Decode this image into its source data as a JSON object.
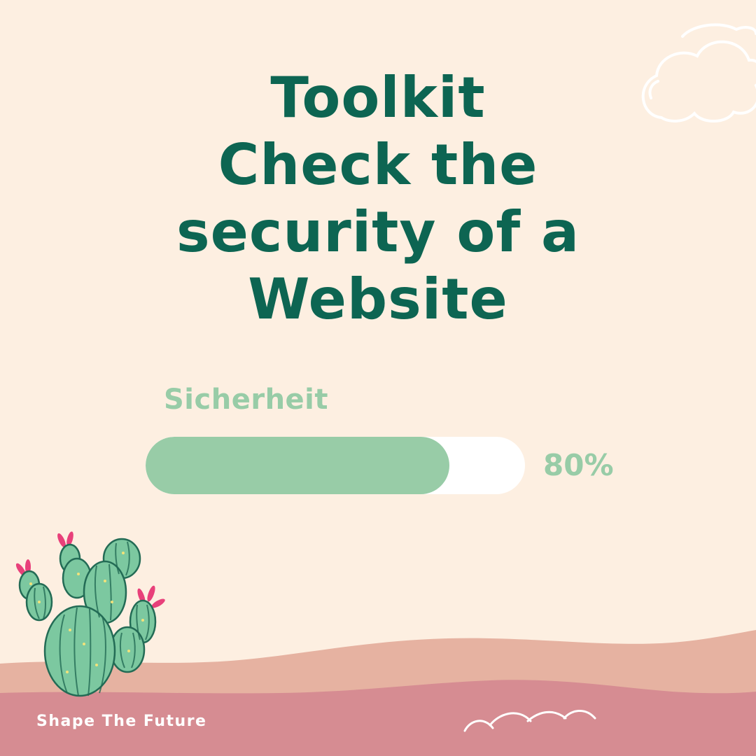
{
  "title": {
    "lines": [
      "Toolkit",
      "Check the",
      "security of a",
      "Website"
    ]
  },
  "progress": {
    "label": "Sicherheit",
    "value_text": "80%",
    "fraction": 0.8
  },
  "footer": {
    "brand": "Shape The Future"
  },
  "colors": {
    "background": "#fdefe1",
    "title": "#0d6552",
    "accent_green": "#98cca7",
    "dune_light": "#e6b2a1",
    "dune_dark": "#d68c92",
    "cactus": "#7cc8a0",
    "flower": "#e8407a"
  },
  "decorations": {
    "cloud": "cloud-icon",
    "cactus": "cactus-illustration",
    "birds": "bird-scribble"
  }
}
